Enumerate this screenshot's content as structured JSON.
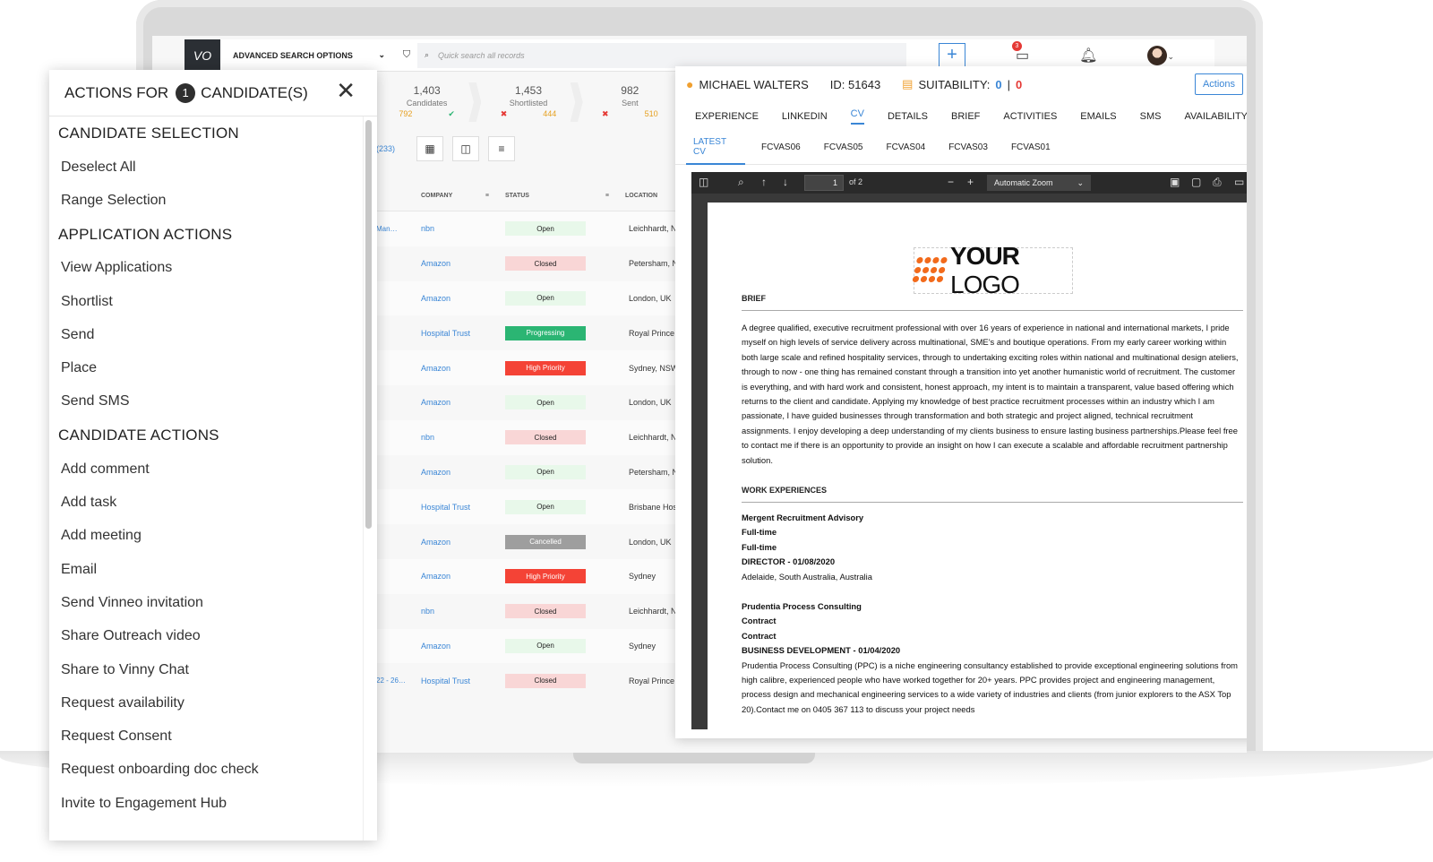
{
  "topbar": {
    "logo_text": "VO",
    "advanced_search": "ADVANCED SEARCH OPTIONS",
    "quick_search_placeholder": "Quick search all records",
    "chat_badge": "3"
  },
  "stats": [
    {
      "value": "1,403",
      "label": "Candidates",
      "sub_a": "792",
      "sub_b": "✔"
    },
    {
      "value": "1,453",
      "label": "Shortlisted",
      "sub_a": "✖",
      "sub_b": "444"
    },
    {
      "value": "982",
      "label": "Sent",
      "sub_a": "✖",
      "sub_b": "510"
    }
  ],
  "toolbar": {
    "count": "(233)"
  },
  "grid": {
    "headers": {
      "company": "COMPANY",
      "status": "STATUS",
      "location": "LOCATION"
    },
    "rows": [
      {
        "job": "Man…",
        "company": "nbn",
        "status": "Open",
        "color": "#e8f8ea",
        "location": "Leichhardt, NSW"
      },
      {
        "job": "",
        "company": "Amazon",
        "status": "Closed",
        "color": "#f9d6d6",
        "location": "Petersham, NSW"
      },
      {
        "job": "",
        "company": "Amazon",
        "status": "Open",
        "color": "#e8f8ea",
        "location": "London, UK"
      },
      {
        "job": "",
        "company": "Hospital Trust",
        "status": "Progressing",
        "color": "#2bb573",
        "location": "Royal Prince Ho"
      },
      {
        "job": "",
        "company": "Amazon",
        "status": "High Priority",
        "color": "#f44336",
        "location": "Sydney, NSW"
      },
      {
        "job": "",
        "company": "Amazon",
        "status": "Open",
        "color": "#e8f8ea",
        "location": "London, UK"
      },
      {
        "job": "",
        "company": "nbn",
        "status": "Closed",
        "color": "#f9d6d6",
        "location": "Leichhardt, NSW"
      },
      {
        "job": "",
        "company": "Amazon",
        "status": "Open",
        "color": "#e8f8ea",
        "location": "Petersham, NSW"
      },
      {
        "job": "",
        "company": "Hospital Trust",
        "status": "Open",
        "color": "#e8f8ea",
        "location": "Brisbane Hospit"
      },
      {
        "job": "",
        "company": "Amazon",
        "status": "Cancelled",
        "color": "#9e9e9e",
        "location": "London, UK"
      },
      {
        "job": "",
        "company": "Amazon",
        "status": "High Priority",
        "color": "#f44336",
        "location": "Sydney"
      },
      {
        "job": "",
        "company": "nbn",
        "status": "Closed",
        "color": "#f9d6d6",
        "location": "Leichhardt, NSW"
      },
      {
        "job": "",
        "company": "Amazon",
        "status": "Open",
        "color": "#e8f8ea",
        "location": "Sydney"
      },
      {
        "job": "22 - 26…",
        "company": "Hospital Trust",
        "status": "Closed",
        "color": "#f9d6d6",
        "location": "Royal Prince Ho"
      }
    ]
  },
  "candidate": {
    "name": "MICHAEL WALTERS",
    "id": "ID: 51643",
    "suitability_label": "SUITABILITY:",
    "suit_a": "0",
    "suit_sep": "|",
    "suit_b": "0",
    "actions_label": "Actions",
    "tabs": [
      "EXPERIENCE",
      "LINKEDIN",
      "CV",
      "DETAILS",
      "BRIEF",
      "ACTIVITIES",
      "EMAILS",
      "SMS",
      "AVAILABILITY"
    ],
    "active_tab": "CV",
    "subtabs": [
      "LATEST CV",
      "FCVAS06",
      "FCVAS05",
      "FCVAS04",
      "FCVAS03",
      "FCVAS01"
    ],
    "active_subtab": "LATEST CV"
  },
  "pdf": {
    "page": "1",
    "of": "of 2",
    "zoom": "Automatic Zoom",
    "logo_bold": "YOUR",
    "logo_thin": " LOGO",
    "brief_title": "BRIEF",
    "brief_text": "A degree qualified, executive recruitment professional with over 16 years of experience in national and international markets, I pride myself on high levels of service delivery across multinational, SME’s and boutique operations. From my early career working within both large scale and refined hospitality services, through to undertaking exciting roles within national and multinational design ateliers, through to now - one thing has remained constant through a transition into yet another humanistic world of recruitment. The customer is everything, and with hard work and consistent, honest approach, my intent is to maintain a transparent, value based offering which returns to the client and candidate. Applying my knowledge of best practice recruitment processes within an industry which I am passionate, I have guided businesses through transformation and both strategic and project aligned, technical recruitment assignments. I enjoy developing a deep understanding of my clients business to ensure lasting business partnerships.Please feel free to contact me if there is an opportunity to provide an insight on how I can execute a scalable and affordable recruitment partnership solution.",
    "work_title": "WORK EXPERIENCES",
    "job1": {
      "company": "Mergent Recruitment Advisory",
      "t1": "Full-time",
      "t2": "Full-time",
      "role": "DIRECTOR - 01/08/2020",
      "loc": "Adelaide, South Australia, Australia"
    },
    "job2": {
      "company": "Prudentia Process Consulting",
      "t1": "Contract",
      "t2": "Contract",
      "role": "BUSINESS DEVELOPMENT - 01/04/2020",
      "desc": "Prudentia Process Consulting (PPC) is a niche engineering consultancy established to provide exceptional engineering solutions from high calibre, experienced people who have worked together for 20+ years. PPC provides project and engineering management, process design and mechanical engineering services to a wide variety of industries and clients (from junior explorers to the ASX Top 20).Contact me on 0405 367 113 to discuss your project needs"
    }
  },
  "actions_panel": {
    "title_pre": "ACTIONS FOR",
    "count": "1",
    "title_post": "CANDIDATE(S)",
    "sections": [
      {
        "title": "CANDIDATE SELECTION",
        "items": [
          "Deselect All",
          "Range Selection"
        ]
      },
      {
        "title": "APPLICATION ACTIONS",
        "items": [
          "View Applications",
          "Shortlist",
          "Send",
          "Place",
          "Send SMS"
        ]
      },
      {
        "title": "CANDIDATE ACTIONS",
        "items": [
          "Add comment",
          "Add task",
          "Add meeting",
          "Email",
          "Send Vinneo invitation",
          "Share Outreach video",
          "Share to Vinny Chat",
          "Request availability",
          "Request Consent",
          "Request onboarding doc check",
          "Invite to Engagement Hub"
        ]
      }
    ]
  }
}
